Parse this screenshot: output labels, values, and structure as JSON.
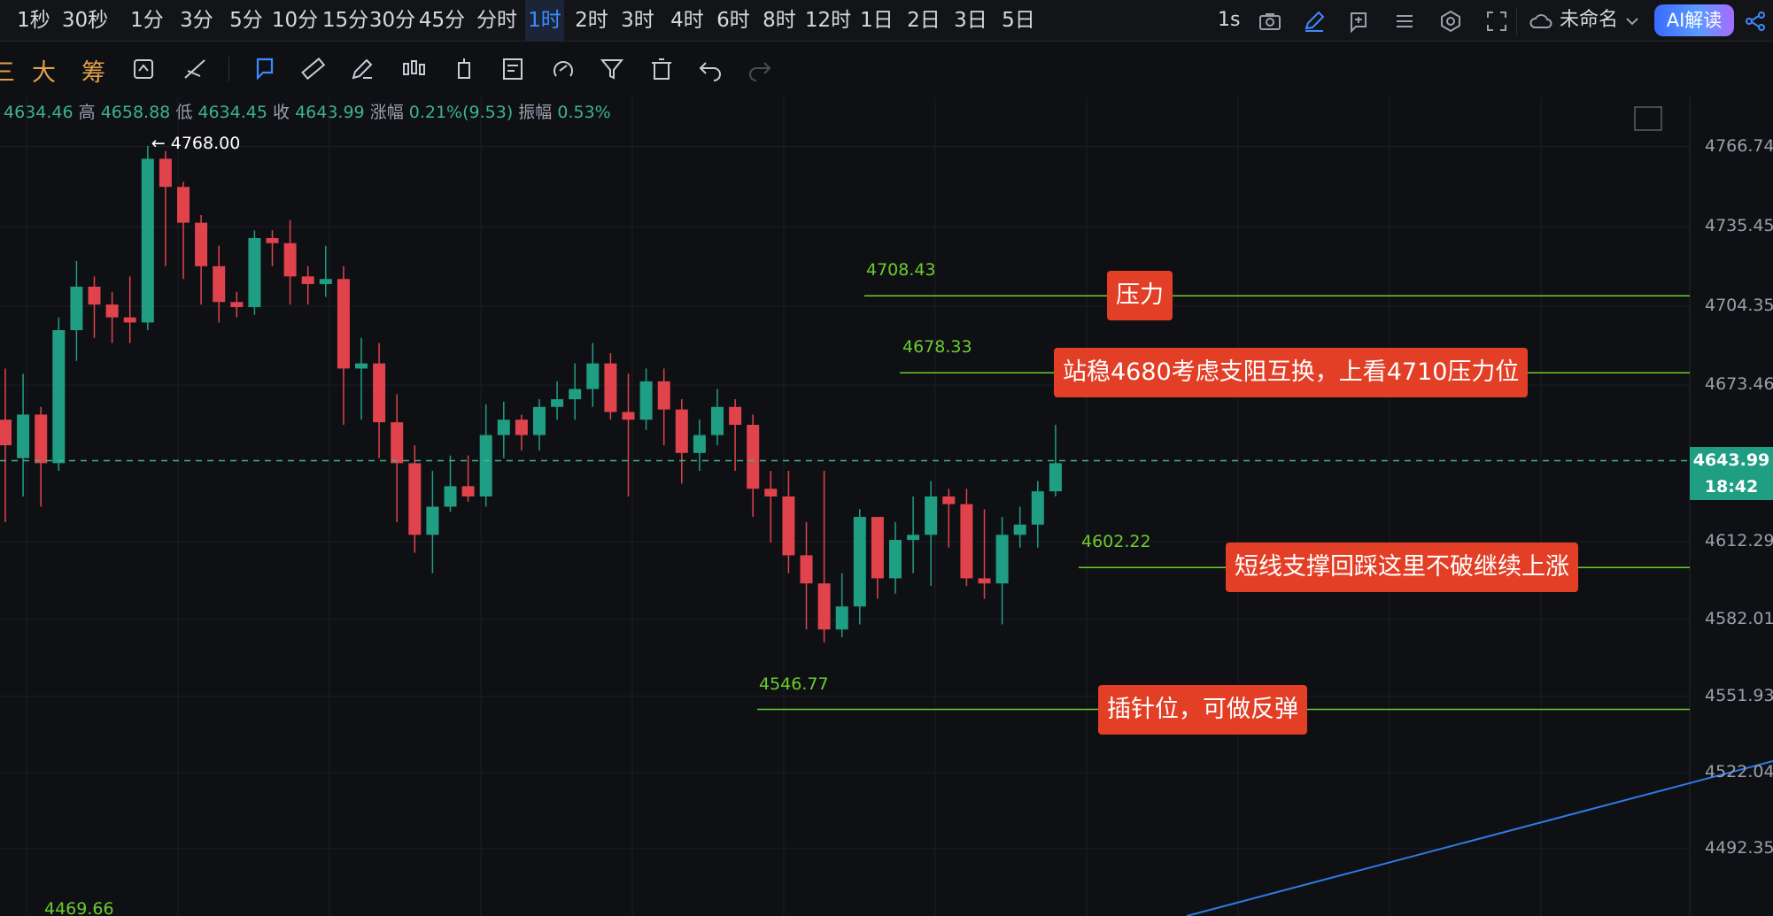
{
  "timeframes": [
    "1秒",
    "30秒",
    "1分",
    "3分",
    "5分",
    "10分",
    "15分",
    "30分",
    "45分",
    "分时",
    "1时",
    "2时",
    "3时",
    "4时",
    "6时",
    "8时",
    "12时",
    "1日",
    "2日",
    "3日",
    "5日"
  ],
  "active_timeframe": "1时",
  "toolbar": {
    "interval_label": "1s",
    "layout_name": "未命名",
    "ai_button": "AI解读",
    "left_chars": [
      "三",
      "大",
      "筹"
    ]
  },
  "ohlc": {
    "open_value": "4634.46",
    "high_label": "高",
    "high_value": "4658.88",
    "low_label": "低",
    "low_value": "4634.45",
    "close_label": "收",
    "close_value": "4643.99",
    "change_label": "涨幅",
    "change_value": "0.21%(9.53)",
    "amplitude_label": "振幅",
    "amplitude_value": "0.53%"
  },
  "price_axis": [
    "4766.74",
    "4735.45",
    "4704.35",
    "4673.46",
    "4612.29",
    "4582.01",
    "4551.93",
    "4522.04",
    "4492.35"
  ],
  "current_price": "4643.99",
  "countdown": "18:42",
  "high_marker": "4768.00",
  "low_marker": "4469.66",
  "levels": [
    {
      "price": "4708.43",
      "value": 4708.43,
      "annotation": "压力"
    },
    {
      "price": "4678.33",
      "value": 4678.33,
      "annotation": "站稳4680考虑支阻互换，上看4710压力位"
    },
    {
      "price": "4602.22",
      "value": 4602.22,
      "annotation": "短线支撑回踩这里不破继续上涨"
    },
    {
      "price": "4546.77",
      "value": 4546.77,
      "annotation": "插针位，可做反弹"
    }
  ],
  "colors": {
    "up": "#1f9e84",
    "down": "#e0434b",
    "level": "#6ccb2e",
    "annotation": "#e23f26",
    "trend": "#2f7ae5",
    "accent": "#3d8bff"
  },
  "chart_data": {
    "type": "candlestick",
    "ylim": [
      4466,
      4786
    ],
    "candles": [
      [
        4660,
        4650,
        4680,
        4620
      ],
      [
        4645,
        4662,
        4678,
        4630
      ],
      [
        4662,
        4643,
        4665,
        4626
      ],
      [
        4643,
        4695,
        4700,
        4640
      ],
      [
        4695,
        4712,
        4722,
        4683
      ],
      [
        4712,
        4705,
        4716,
        4692
      ],
      [
        4705,
        4700,
        4710,
        4690
      ],
      [
        4700,
        4698,
        4716,
        4690
      ],
      [
        4698,
        4762,
        4767,
        4695
      ],
      [
        4762,
        4751,
        4765,
        4720
      ],
      [
        4751,
        4737,
        4753,
        4715
      ],
      [
        4737,
        4720,
        4740,
        4705
      ],
      [
        4720,
        4706,
        4728,
        4698
      ],
      [
        4706,
        4704,
        4710,
        4700
      ],
      [
        4704,
        4731,
        4734,
        4701
      ],
      [
        4731,
        4729,
        4734,
        4720
      ],
      [
        4729,
        4716,
        4738,
        4705
      ],
      [
        4716,
        4713,
        4720,
        4705
      ],
      [
        4713,
        4715,
        4728,
        4708
      ],
      [
        4715,
        4680,
        4720,
        4658
      ],
      [
        4680,
        4682,
        4692,
        4660
      ],
      [
        4682,
        4659,
        4690,
        4645
      ],
      [
        4659,
        4643,
        4670,
        4620
      ],
      [
        4643,
        4615,
        4650,
        4608
      ],
      [
        4615,
        4626,
        4640,
        4600
      ],
      [
        4626,
        4634,
        4646,
        4624
      ],
      [
        4634,
        4630,
        4646,
        4628
      ],
      [
        4630,
        4654,
        4666,
        4626
      ],
      [
        4654,
        4660,
        4667,
        4645
      ],
      [
        4660,
        4654,
        4662,
        4648
      ],
      [
        4654,
        4665,
        4668,
        4648
      ],
      [
        4665,
        4668,
        4675,
        4660
      ],
      [
        4668,
        4672,
        4682,
        4660
      ],
      [
        4672,
        4682,
        4690,
        4665
      ],
      [
        4682,
        4663,
        4686,
        4660
      ],
      [
        4663,
        4660,
        4678,
        4630
      ],
      [
        4660,
        4675,
        4680,
        4656
      ],
      [
        4675,
        4664,
        4680,
        4650
      ],
      [
        4664,
        4647,
        4668,
        4635
      ],
      [
        4647,
        4654,
        4660,
        4640
      ],
      [
        4654,
        4665,
        4672,
        4650
      ],
      [
        4665,
        4658,
        4668,
        4640
      ],
      [
        4658,
        4633,
        4662,
        4622
      ],
      [
        4633,
        4630,
        4640,
        4612
      ],
      [
        4630,
        4607,
        4640,
        4600
      ],
      [
        4607,
        4596,
        4620,
        4578
      ],
      [
        4596,
        4578,
        4640,
        4573
      ],
      [
        4578,
        4587,
        4600,
        4575
      ],
      [
        4587,
        4622,
        4625,
        4580
      ],
      [
        4622,
        4598,
        4622,
        4590
      ],
      [
        4598,
        4613,
        4620,
        4592
      ],
      [
        4613,
        4615,
        4630,
        4600
      ],
      [
        4615,
        4630,
        4636,
        4595
      ],
      [
        4630,
        4627,
        4633,
        4610
      ],
      [
        4627,
        4598,
        4633,
        4595
      ],
      [
        4598,
        4596,
        4625,
        4590
      ],
      [
        4596,
        4615,
        4622,
        4580
      ],
      [
        4615,
        4619,
        4626,
        4610
      ],
      [
        4619,
        4632,
        4636,
        4610
      ],
      [
        4632,
        4643,
        4658,
        4630
      ]
    ]
  }
}
